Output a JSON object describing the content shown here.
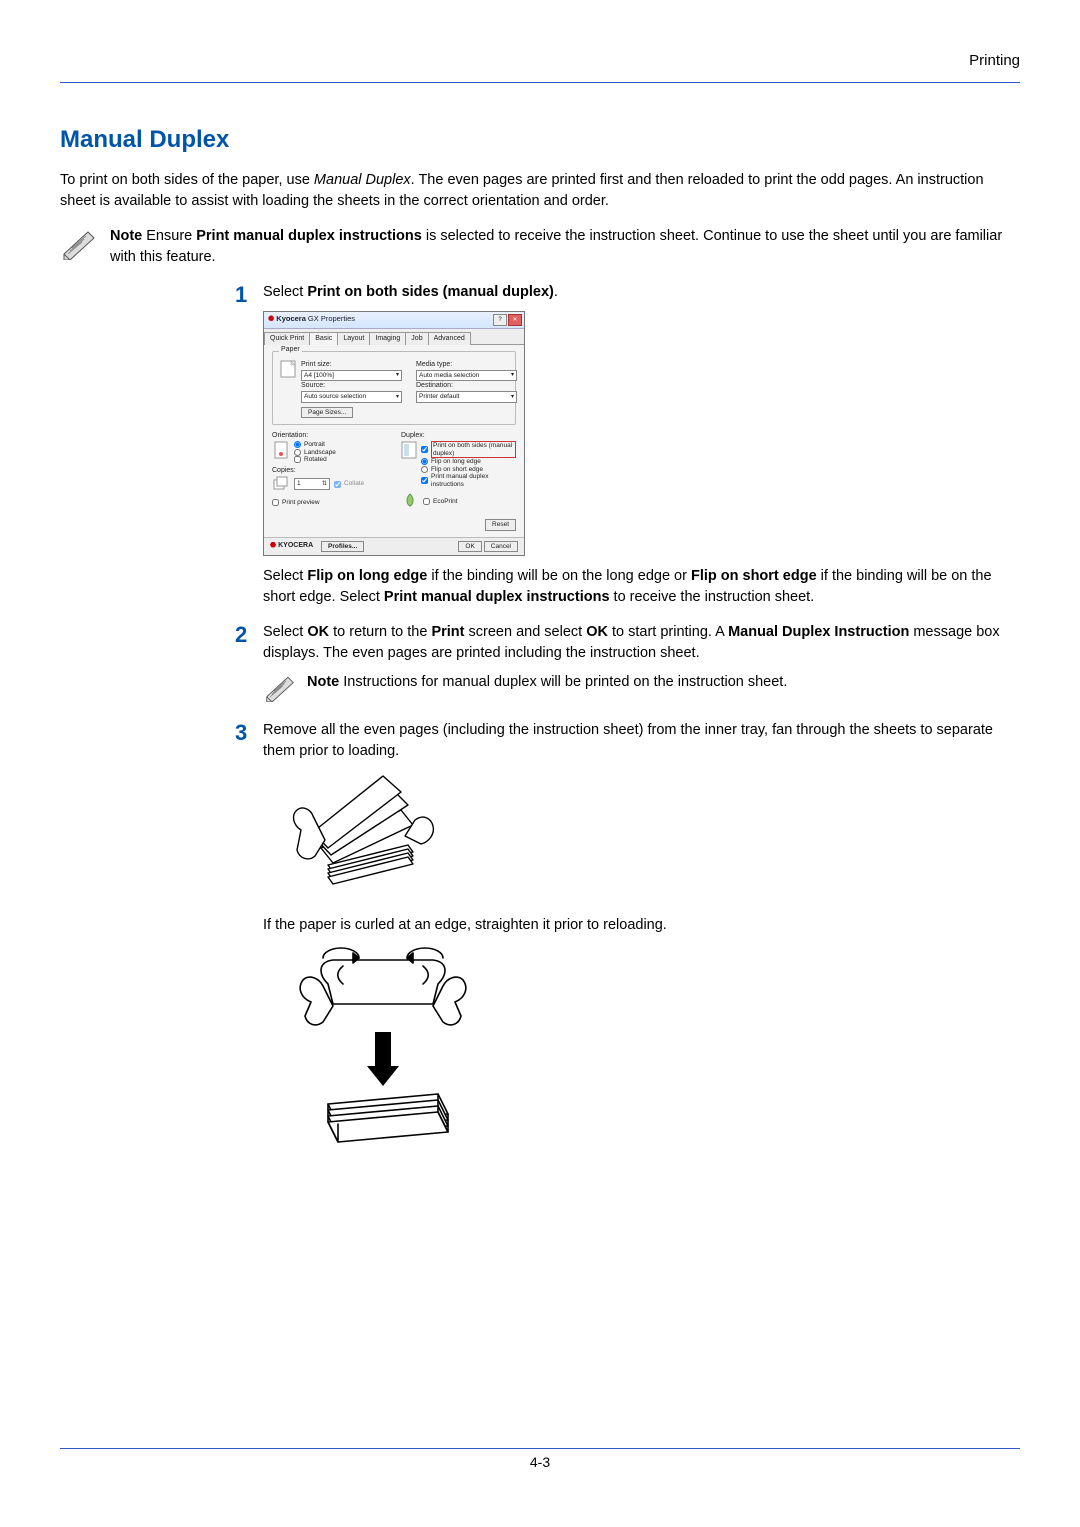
{
  "header": {
    "section": "Printing"
  },
  "heading": "Manual Duplex",
  "intro_a": "To print on both sides of the paper, use ",
  "intro_b": ". The even pages are printed first and then reloaded to print the odd pages. An instruction sheet is available to assist with loading the sheets in the correct orientation and order.",
  "intro_em": "Manual Duplex",
  "note1_prefix": "Note",
  "note1_a": "  Ensure ",
  "note1_bold": "Print manual duplex instructions",
  "note1_b": " is selected to receive the instruction sheet. Continue to use the sheet until you are familiar with this feature.",
  "step1": {
    "num": "1",
    "lead_a": "Select ",
    "lead_bold": "Print on both sides (manual duplex)",
    "lead_b": ".",
    "follow_a": "Select ",
    "follow_b1": "Flip on long edge",
    "follow_c": " if the binding will be on the long edge or ",
    "follow_b2": "Flip on short edge",
    "follow_d": " if the binding will be on the short edge. Select ",
    "follow_b3": "Print manual duplex instructions",
    "follow_e": " to receive the instruction sheet."
  },
  "step2": {
    "num": "2",
    "a": "Select ",
    "b1": "OK",
    "c": " to return to the ",
    "b2": "Print",
    "d": " screen and select ",
    "b3": "OK",
    "e": " to start printing. A ",
    "b4": "Manual Duplex Instruction",
    "f": " message box displays. The even pages are printed including the instruction sheet.",
    "note_prefix": "Note",
    "note_text": "  Instructions for manual duplex will be printed on the instruction sheet."
  },
  "step3": {
    "num": "3",
    "text": "Remove all the even pages (including the instruction sheet) from the inner tray, fan through the sheets to separate them prior to loading.",
    "text2": "If the paper is curled at an edge, straighten it prior to reloading."
  },
  "dialog": {
    "title_brand": "Kyocera",
    "title_rest": " GX Properties",
    "tabs": [
      "Quick Print",
      "Basic",
      "Layout",
      "Imaging",
      "Job",
      "Advanced"
    ],
    "paper_legend": "Paper",
    "print_size_label": "Print size:",
    "print_size_value": "A4 [100%]",
    "source_label": "Source:",
    "source_value": "Auto source selection",
    "media_label": "Media type:",
    "media_value": "Auto media selection",
    "dest_label": "Destination:",
    "dest_value": "Printer default",
    "page_sizes_btn": "Page Sizes...",
    "orientation_legend": "Orientation:",
    "orientation_portrait": "Portrait",
    "orientation_landscape": "Landscape",
    "orientation_rotated": "Rotated",
    "copies_legend": "Copies:",
    "copies_value": "1",
    "collate": "Collate",
    "print_preview": "Print preview",
    "duplex_legend": "Duplex:",
    "duplex_both": "Print on both sides (manual duplex)",
    "duplex_long": "Flip on long edge",
    "duplex_short": "Flip on short edge",
    "duplex_instr": "Print manual duplex instructions",
    "ecoprint": "EcoPrint",
    "reset_btn": "Reset",
    "brand_footer": "KYOCERA",
    "profiles_btn": "Profiles...",
    "ok_btn": "OK",
    "cancel_btn": "Cancel"
  },
  "page_number": "4-3"
}
